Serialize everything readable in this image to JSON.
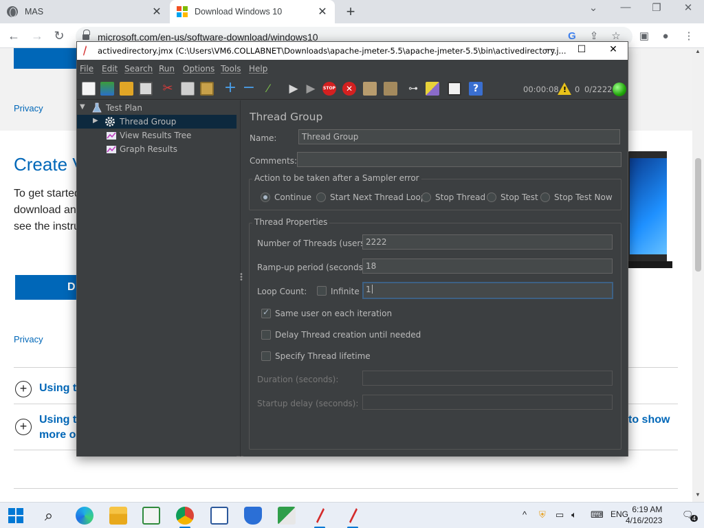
{
  "browser": {
    "tabs": [
      {
        "label": "MAS",
        "active": false
      },
      {
        "label": "Download Windows 10",
        "active": true
      }
    ],
    "url": "microsoft.com/en-us/software-download/windows10"
  },
  "webpage": {
    "privacy_1": "Privacy",
    "heading": "Create V",
    "para_lines": [
      "To get started",
      "download an",
      "see the instru"
    ],
    "download_button": "D",
    "privacy_2": "Privacy",
    "accordion": [
      {
        "line1": "Using th",
        "line2": ""
      },
      {
        "line1": "Using th",
        "line2": "more o"
      }
    ],
    "right_fragment": "to show"
  },
  "jmeter": {
    "title": "activedirectory.jmx (C:\\Users\\VM6.COLLABNET\\Downloads\\apache-jmeter-5.5\\apache-jmeter-5.5\\bin\\activedirectory.j...",
    "menu": [
      "File",
      "Edit",
      "Search",
      "Run",
      "Options",
      "Tools",
      "Help"
    ],
    "toolbar": {
      "elapsed": "00:00:08",
      "warnings": "0",
      "threads": "0/2222"
    },
    "tree": [
      {
        "label": "Test Plan",
        "icon": "test-plan-icon",
        "level": 0,
        "expanded": true
      },
      {
        "label": "Thread Group",
        "icon": "gear-icon",
        "level": 1,
        "selected": true,
        "collapsed": true
      },
      {
        "label": "View Results Tree",
        "icon": "listener-chart-icon",
        "level": 1
      },
      {
        "label": "Graph Results",
        "icon": "listener-chart-icon",
        "level": 1
      }
    ],
    "panel": {
      "title": "Thread Group",
      "name_label": "Name:",
      "name_value": "Thread Group",
      "comments_label": "Comments:",
      "comments_value": "",
      "sampler_error_title": "Action to be taken after a Sampler error",
      "sampler_error_options": [
        "Continue",
        "Start Next Thread Loop",
        "Stop Thread",
        "Stop Test",
        "Stop Test Now"
      ],
      "sampler_error_selected": "Continue",
      "thread_props_title": "Thread Properties",
      "threads_label": "Number of Threads (users):",
      "threads_value": "2222",
      "rampup_label": "Ramp-up period (seconds):",
      "rampup_value": "18",
      "loop_label": "Loop Count:",
      "infinite_label": "Infinite",
      "infinite_checked": false,
      "loop_value": "1",
      "same_user_label": "Same user on each iteration",
      "same_user_checked": true,
      "delay_label": "Delay Thread creation until needed",
      "delay_checked": false,
      "lifetime_label": "Specify Thread lifetime",
      "lifetime_checked": false,
      "duration_label": "Duration (seconds):",
      "duration_value": "",
      "startup_label": "Startup delay (seconds):",
      "startup_value": ""
    }
  },
  "taskbar": {
    "lang": "ENG",
    "time": "6:19 AM",
    "date": "4/16/2023",
    "notification_count": "4"
  },
  "colors": {
    "jmeter_bg": "#3c3f41",
    "jmeter_selection": "#0d293e",
    "ms_blue": "#0067b8",
    "taskbar": "#e9eef6"
  }
}
